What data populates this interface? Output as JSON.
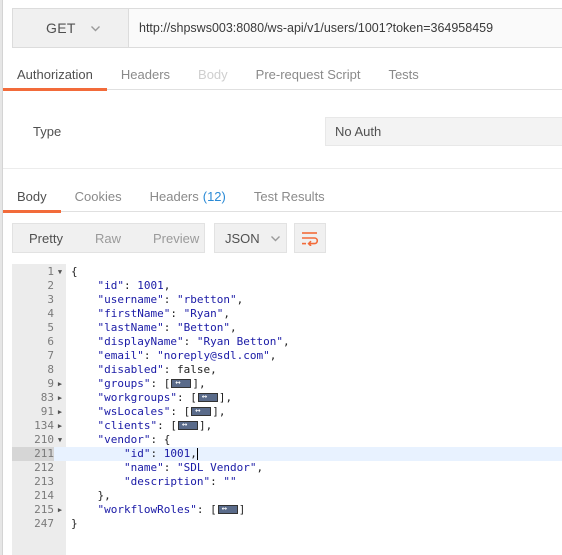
{
  "request": {
    "method": "GET",
    "url": "http://shpsws003:8080/ws-api/v1/users/1001?token=364958459"
  },
  "request_tabs": [
    {
      "label": "Authorization",
      "state": "active"
    },
    {
      "label": "Headers",
      "state": "normal"
    },
    {
      "label": "Body",
      "state": "disabled"
    },
    {
      "label": "Pre-request Script",
      "state": "normal"
    },
    {
      "label": "Tests",
      "state": "normal"
    }
  ],
  "auth": {
    "type_label": "Type",
    "type_value": "No Auth"
  },
  "response_tabs": [
    {
      "label": "Body",
      "count": "",
      "state": "active"
    },
    {
      "label": "Cookies",
      "count": "",
      "state": "normal"
    },
    {
      "label": "Headers",
      "count": "(12)",
      "state": "normal"
    },
    {
      "label": "Test Results",
      "count": "",
      "state": "normal"
    }
  ],
  "view_modes": [
    "Pretty",
    "Raw",
    "Preview"
  ],
  "active_view_mode": "Pretty",
  "format": "JSON",
  "icons": {
    "method_chevron": "chevron-down-icon",
    "format_chevron": "chevron-down-icon",
    "wrap": "wrap-lines-icon"
  },
  "colors": {
    "accent": "#f26b3a",
    "count": "#2a8ad6",
    "json_token": "#1a1aa6"
  },
  "code_lines": [
    {
      "num": "1",
      "fold": "open",
      "indent": 0,
      "tokens": [
        {
          "t": "p",
          "v": "{"
        }
      ]
    },
    {
      "num": "2",
      "fold": "",
      "indent": 1,
      "tokens": [
        {
          "t": "k",
          "v": "\"id\""
        },
        {
          "t": "p",
          "v": ": "
        },
        {
          "t": "n",
          "v": "1001"
        },
        {
          "t": "p",
          "v": ","
        }
      ]
    },
    {
      "num": "3",
      "fold": "",
      "indent": 1,
      "tokens": [
        {
          "t": "k",
          "v": "\"username\""
        },
        {
          "t": "p",
          "v": ": "
        },
        {
          "t": "s",
          "v": "\"rbetton\""
        },
        {
          "t": "p",
          "v": ","
        }
      ]
    },
    {
      "num": "4",
      "fold": "",
      "indent": 1,
      "tokens": [
        {
          "t": "k",
          "v": "\"firstName\""
        },
        {
          "t": "p",
          "v": ": "
        },
        {
          "t": "s",
          "v": "\"Ryan\""
        },
        {
          "t": "p",
          "v": ","
        }
      ]
    },
    {
      "num": "5",
      "fold": "",
      "indent": 1,
      "tokens": [
        {
          "t": "k",
          "v": "\"lastName\""
        },
        {
          "t": "p",
          "v": ": "
        },
        {
          "t": "s",
          "v": "\"Betton\""
        },
        {
          "t": "p",
          "v": ","
        }
      ]
    },
    {
      "num": "6",
      "fold": "",
      "indent": 1,
      "tokens": [
        {
          "t": "k",
          "v": "\"displayName\""
        },
        {
          "t": "p",
          "v": ": "
        },
        {
          "t": "s",
          "v": "\"Ryan Betton\""
        },
        {
          "t": "p",
          "v": ","
        }
      ]
    },
    {
      "num": "7",
      "fold": "",
      "indent": 1,
      "tokens": [
        {
          "t": "k",
          "v": "\"email\""
        },
        {
          "t": "p",
          "v": ": "
        },
        {
          "t": "s",
          "v": "\"noreply@sdl.com\""
        },
        {
          "t": "p",
          "v": ","
        }
      ]
    },
    {
      "num": "8",
      "fold": "",
      "indent": 1,
      "tokens": [
        {
          "t": "k",
          "v": "\"disabled\""
        },
        {
          "t": "p",
          "v": ": false,"
        }
      ]
    },
    {
      "num": "9",
      "fold": "closed",
      "indent": 1,
      "tokens": [
        {
          "t": "k",
          "v": "\"groups\""
        },
        {
          "t": "p",
          "v": ": ["
        },
        {
          "t": "c",
          "v": ""
        },
        {
          "t": "p",
          "v": "],"
        }
      ]
    },
    {
      "num": "83",
      "fold": "closed",
      "indent": 1,
      "tokens": [
        {
          "t": "k",
          "v": "\"workgroups\""
        },
        {
          "t": "p",
          "v": ": ["
        },
        {
          "t": "c",
          "v": ""
        },
        {
          "t": "p",
          "v": "],"
        }
      ]
    },
    {
      "num": "91",
      "fold": "closed",
      "indent": 1,
      "tokens": [
        {
          "t": "k",
          "v": "\"wsLocales\""
        },
        {
          "t": "p",
          "v": ": ["
        },
        {
          "t": "c",
          "v": ""
        },
        {
          "t": "p",
          "v": "],"
        }
      ]
    },
    {
      "num": "134",
      "fold": "closed",
      "indent": 1,
      "tokens": [
        {
          "t": "k",
          "v": "\"clients\""
        },
        {
          "t": "p",
          "v": ": ["
        },
        {
          "t": "c",
          "v": ""
        },
        {
          "t": "p",
          "v": "],"
        }
      ]
    },
    {
      "num": "210",
      "fold": "open",
      "indent": 1,
      "tokens": [
        {
          "t": "k",
          "v": "\"vendor\""
        },
        {
          "t": "p",
          "v": ": {"
        }
      ]
    },
    {
      "num": "211",
      "fold": "",
      "indent": 2,
      "current": true,
      "tokens": [
        {
          "t": "k",
          "v": "\"id\""
        },
        {
          "t": "p",
          "v": ": "
        },
        {
          "t": "n",
          "v": "1001"
        },
        {
          "t": "p",
          "v": ","
        },
        {
          "t": "cursor",
          "v": ""
        }
      ]
    },
    {
      "num": "212",
      "fold": "",
      "indent": 2,
      "tokens": [
        {
          "t": "k",
          "v": "\"name\""
        },
        {
          "t": "p",
          "v": ": "
        },
        {
          "t": "s",
          "v": "\"SDL Vendor\""
        },
        {
          "t": "p",
          "v": ","
        }
      ]
    },
    {
      "num": "213",
      "fold": "",
      "indent": 2,
      "tokens": [
        {
          "t": "k",
          "v": "\"description\""
        },
        {
          "t": "p",
          "v": ": "
        },
        {
          "t": "s",
          "v": "\"\""
        }
      ]
    },
    {
      "num": "214",
      "fold": "",
      "indent": 1,
      "tokens": [
        {
          "t": "p",
          "v": "},"
        }
      ]
    },
    {
      "num": "215",
      "fold": "closed",
      "indent": 1,
      "tokens": [
        {
          "t": "k",
          "v": "\"workflowRoles\""
        },
        {
          "t": "p",
          "v": ": ["
        },
        {
          "t": "c",
          "v": ""
        },
        {
          "t": "p",
          "v": "]"
        }
      ]
    },
    {
      "num": "247",
      "fold": "",
      "indent": 0,
      "tokens": [
        {
          "t": "p",
          "v": "}"
        }
      ]
    }
  ]
}
